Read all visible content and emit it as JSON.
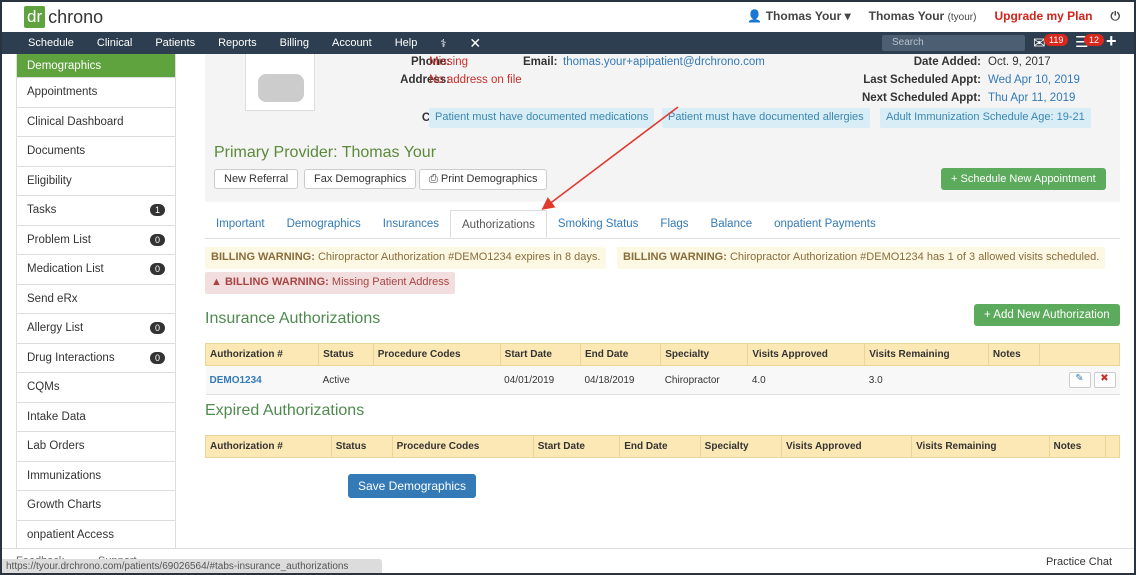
{
  "brand": {
    "logo": "dr chrono"
  },
  "top": {
    "user_menu": "Thomas Your",
    "user_name": "Thomas Your",
    "user_handle": "(tyour)",
    "upgrade": "Upgrade my Plan"
  },
  "nav": {
    "items": [
      "Schedule",
      "Clinical",
      "Patients",
      "Reports",
      "Billing",
      "Account",
      "Help"
    ],
    "search_placeholder": "Search",
    "mail_count": "119",
    "tasks_count": "12"
  },
  "sidebar": {
    "items": [
      {
        "label": "Demographics",
        "count": null
      },
      {
        "label": "Appointments",
        "count": null
      },
      {
        "label": "Clinical Dashboard",
        "count": null
      },
      {
        "label": "Documents",
        "count": null
      },
      {
        "label": "Eligibility",
        "count": null
      },
      {
        "label": "Tasks",
        "count": "1"
      },
      {
        "label": "Problem List",
        "count": "0"
      },
      {
        "label": "Medication List",
        "count": "0"
      },
      {
        "label": "Send eRx",
        "count": null
      },
      {
        "label": "Allergy List",
        "count": "0"
      },
      {
        "label": "Drug Interactions",
        "count": "0"
      },
      {
        "label": "CQMs",
        "count": null
      },
      {
        "label": "Intake Data",
        "count": null
      },
      {
        "label": "Lab Orders",
        "count": null
      },
      {
        "label": "Immunizations",
        "count": null
      },
      {
        "label": "Growth Charts",
        "count": null
      },
      {
        "label": "onpatient Access",
        "count": null
      }
    ]
  },
  "patient": {
    "phone_label": "Phone:",
    "phone": "Missing",
    "address_label": "Address:",
    "address": "No address on file",
    "email_label": "Email:",
    "email": "thomas.your+apipatient@drchrono.com",
    "date_added_label": "Date Added:",
    "date_added": "Oct. 9, 2017",
    "last_appt_label": "Last Scheduled Appt:",
    "last_appt": "Wed Apr 10, 2019",
    "next_appt_label": "Next Scheduled Appt:",
    "next_appt": "Thu Apr 11, 2019",
    "cds_label": "CDS:",
    "cds": [
      "Patient must have documented medications",
      "Patient must have documented allergies",
      "Adult Immunization Schedule Age: 19-21"
    ],
    "primary_provider": "Primary Provider: Thomas Your",
    "buttons": {
      "new_referral": "New Referral",
      "fax": "Fax Demographics",
      "print": "Print Demographics",
      "schedule": "Schedule New Appointment"
    }
  },
  "tabs": [
    "Important",
    "Demographics",
    "Insurances",
    "Authorizations",
    "Smoking Status",
    "Flags",
    "Balance",
    "onpatient Payments"
  ],
  "active_tab": "Authorizations",
  "warnings": [
    {
      "prefix": "BILLING WARNING:",
      "text": " Chiropractor Authorization #DEMO1234 expires in 8 days."
    },
    {
      "prefix": "BILLING WARNING:",
      "text": " Chiropractor Authorization #DEMO1234 has 1 of 3 allowed visits scheduled."
    },
    {
      "prefix": "BILLING WARNING:",
      "text": " Missing Patient Address"
    }
  ],
  "insurance": {
    "title": "Insurance Authorizations",
    "add_button": "Add New Authorization",
    "columns": [
      "Authorization #",
      "Status",
      "Procedure Codes",
      "Start Date",
      "End Date",
      "Specialty",
      "Visits Approved",
      "Visits Remaining",
      "Notes"
    ],
    "rows": [
      [
        "DEMO1234",
        "Active",
        "",
        "04/01/2019",
        "04/18/2019",
        "Chiropractor",
        "4.0",
        "3.0",
        ""
      ]
    ]
  },
  "expired": {
    "title": "Expired Authorizations",
    "columns": [
      "Authorization #",
      "Status",
      "Procedure Codes",
      "Start Date",
      "End Date",
      "Specialty",
      "Visits Approved",
      "Visits Remaining",
      "Notes"
    ]
  },
  "save_button": "Save Demographics",
  "footer": {
    "feedback": "Feedback",
    "support": "Support",
    "url": "https://tyour.drchrono.com/patients/69026564/#tabs-insurance_authorizations",
    "chat": "Practice Chat"
  },
  "colors": {
    "brand_green": "#5fa33f",
    "nav": "#2c3e50",
    "upgrade": "#d0231a",
    "arrow": "#e03a2f"
  }
}
